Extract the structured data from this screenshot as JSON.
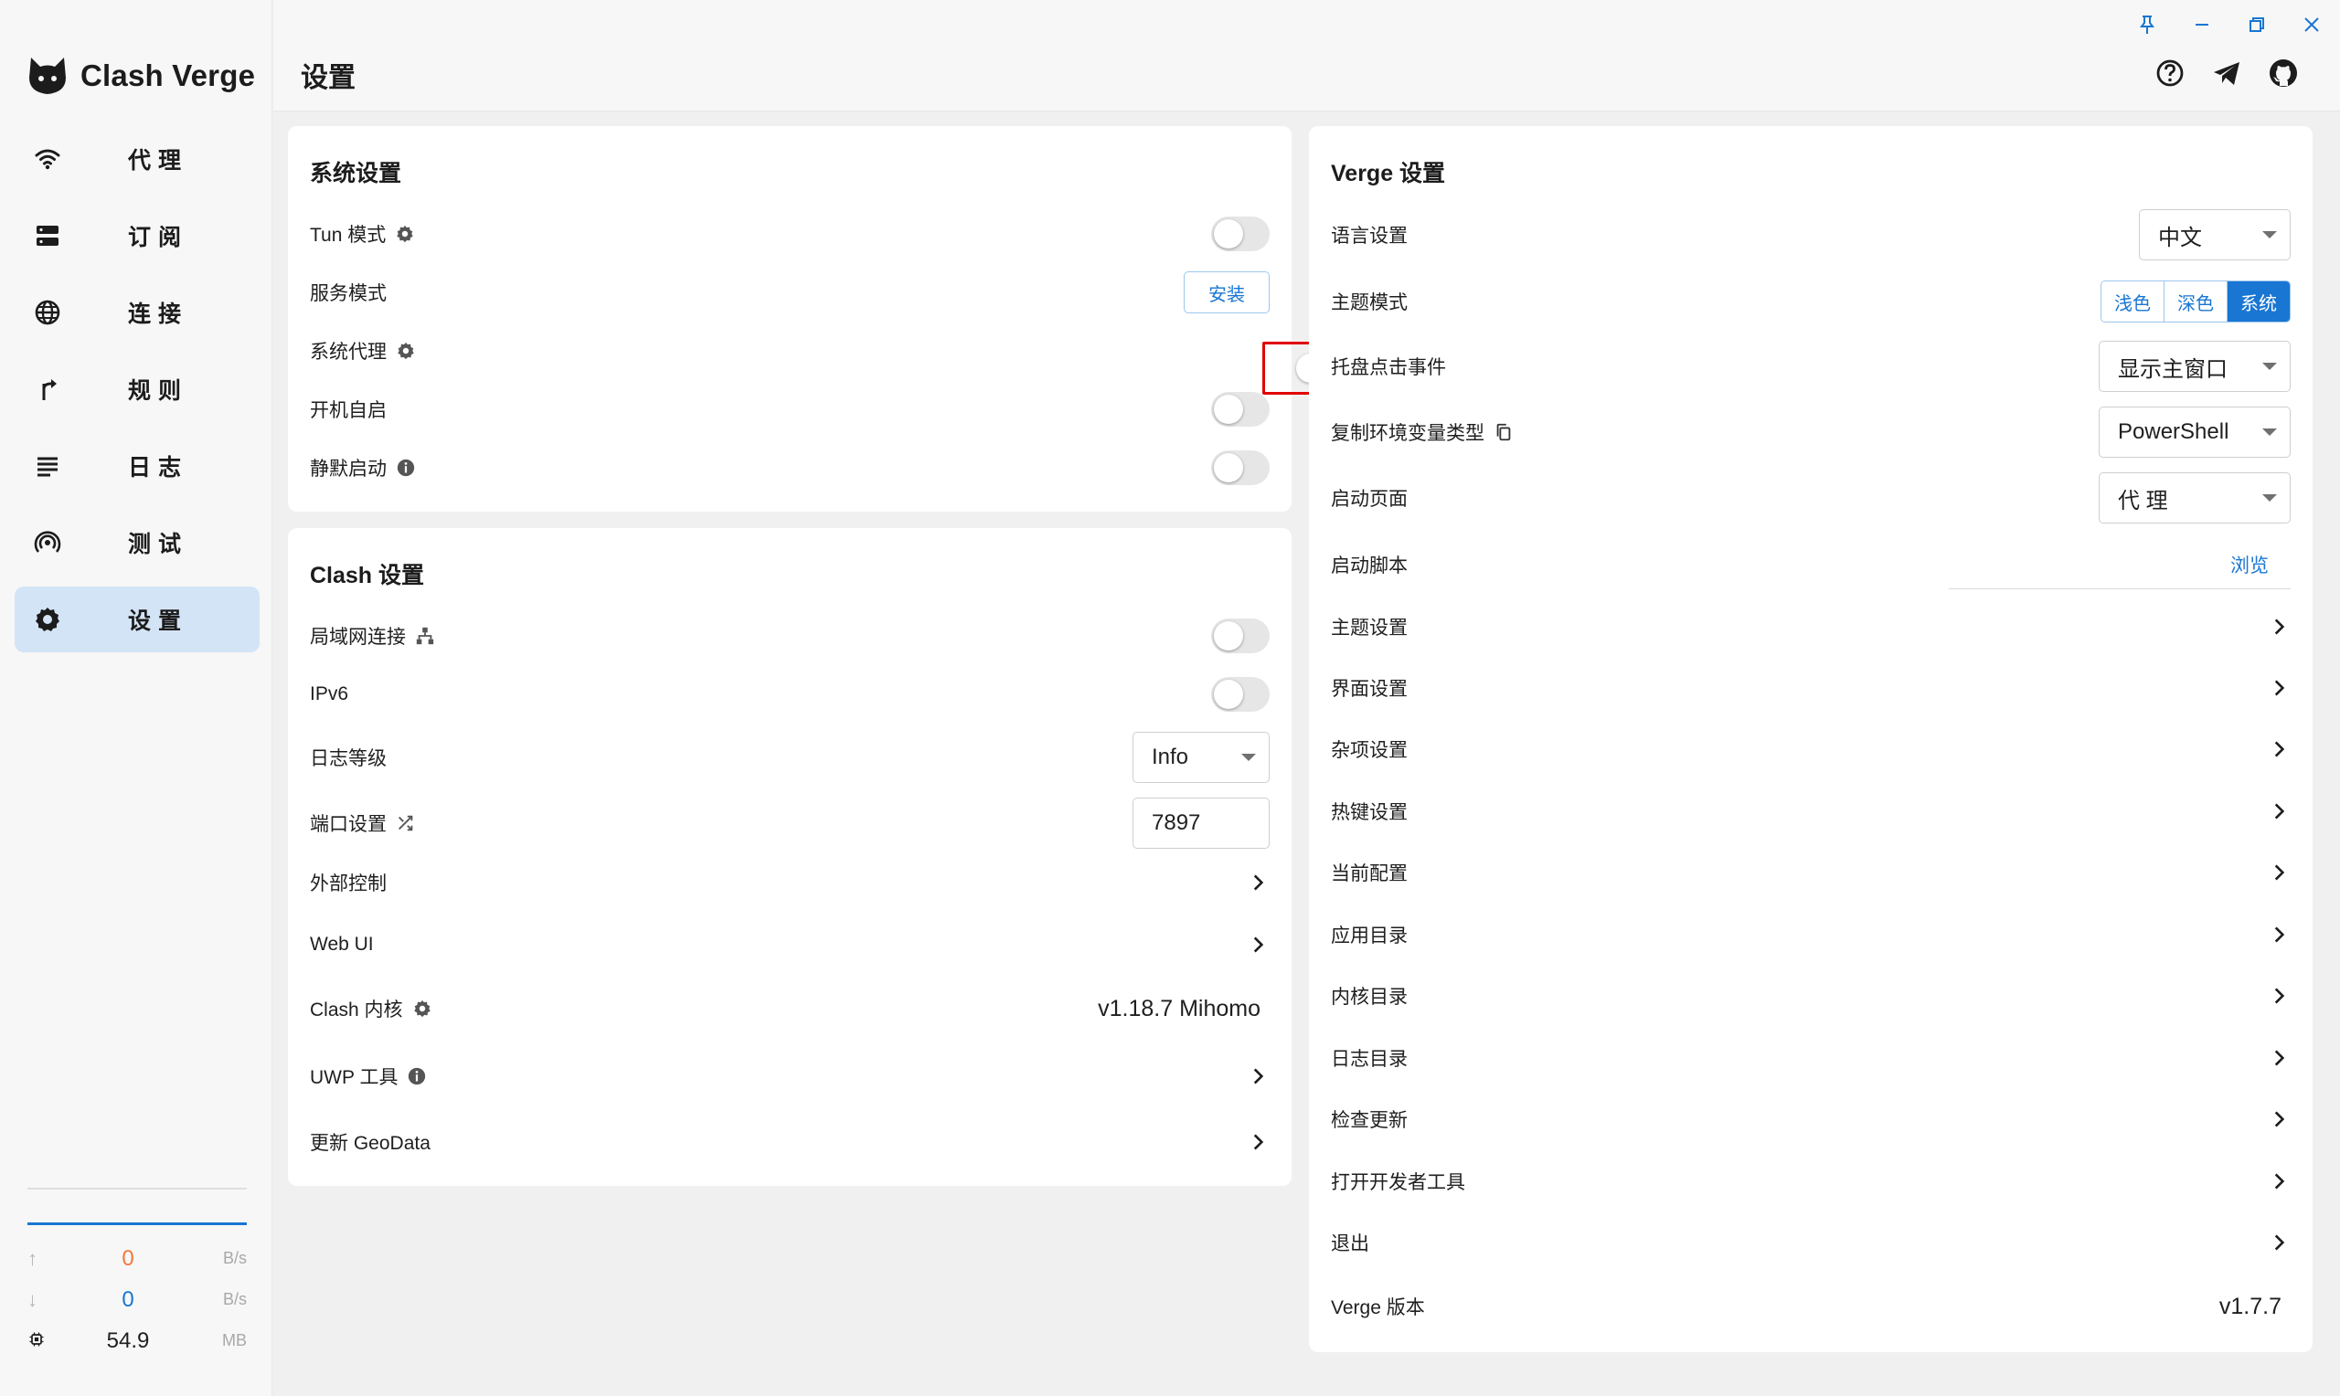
{
  "app": {
    "name": "Clash Verge"
  },
  "sidebar": {
    "items": [
      {
        "label": "代理",
        "icon": "wifi-icon"
      },
      {
        "label": "订阅",
        "icon": "server-icon"
      },
      {
        "label": "连接",
        "icon": "globe-icon"
      },
      {
        "label": "规则",
        "icon": "fork-icon"
      },
      {
        "label": "日志",
        "icon": "list-icon"
      },
      {
        "label": "测试",
        "icon": "broadcast-icon"
      },
      {
        "label": "设置",
        "icon": "gear-icon"
      }
    ],
    "active_index": 6,
    "traffic": {
      "upload": {
        "value": "0",
        "unit": "B/s",
        "color": "#f4773b"
      },
      "download": {
        "value": "0",
        "unit": "B/s",
        "color": "#1976d2"
      },
      "memory": {
        "value": "54.9",
        "unit": "MB"
      }
    }
  },
  "header": {
    "title": "设置"
  },
  "system_settings": {
    "title": "系统设置",
    "tun_mode": {
      "label": "Tun 模式",
      "enabled": false
    },
    "service_mode": {
      "label": "服务模式",
      "button": "安装"
    },
    "system_proxy": {
      "label": "系统代理",
      "enabled": true
    },
    "auto_launch": {
      "label": "开机自启",
      "enabled": false
    },
    "silent_start": {
      "label": "静默启动",
      "enabled": false
    }
  },
  "clash_settings": {
    "title": "Clash 设置",
    "lan": {
      "label": "局域网连接",
      "enabled": false
    },
    "ipv6": {
      "label": "IPv6",
      "enabled": false
    },
    "log_level": {
      "label": "日志等级",
      "value": "Info"
    },
    "port": {
      "label": "端口设置",
      "value": "7897"
    },
    "external_control": {
      "label": "外部控制"
    },
    "web_ui": {
      "label": "Web UI"
    },
    "core": {
      "label": "Clash 内核",
      "value": "v1.18.7 Mihomo"
    },
    "uwp": {
      "label": "UWP 工具"
    },
    "geodata": {
      "label": "更新 GeoData"
    }
  },
  "verge_settings": {
    "title": "Verge 设置",
    "language": {
      "label": "语言设置",
      "value": "中文"
    },
    "theme_mode": {
      "label": "主题模式",
      "options": [
        "浅色",
        "深色",
        "系统"
      ],
      "selected": "系统"
    },
    "tray_click": {
      "label": "托盘点击事件",
      "value": "显示主窗口"
    },
    "copy_env": {
      "label": "复制环境变量类型",
      "value": "PowerShell"
    },
    "start_page": {
      "label": "启动页面",
      "value": "代 理"
    },
    "start_script": {
      "label": "启动脚本",
      "button": "浏览"
    },
    "theme_settings": {
      "label": "主题设置"
    },
    "ui_settings": {
      "label": "界面设置"
    },
    "misc_settings": {
      "label": "杂项设置"
    },
    "hotkey_settings": {
      "label": "热键设置"
    },
    "current_config": {
      "label": "当前配置"
    },
    "app_dir": {
      "label": "应用目录"
    },
    "core_dir": {
      "label": "内核目录"
    },
    "log_dir": {
      "label": "日志目录"
    },
    "check_update": {
      "label": "检查更新"
    },
    "devtools": {
      "label": "打开开发者工具"
    },
    "exit": {
      "label": "退出"
    },
    "version": {
      "label": "Verge 版本",
      "value": "v1.7.7"
    }
  },
  "colors": {
    "accent": "#1976d2",
    "highlight_border": "#e00000"
  }
}
